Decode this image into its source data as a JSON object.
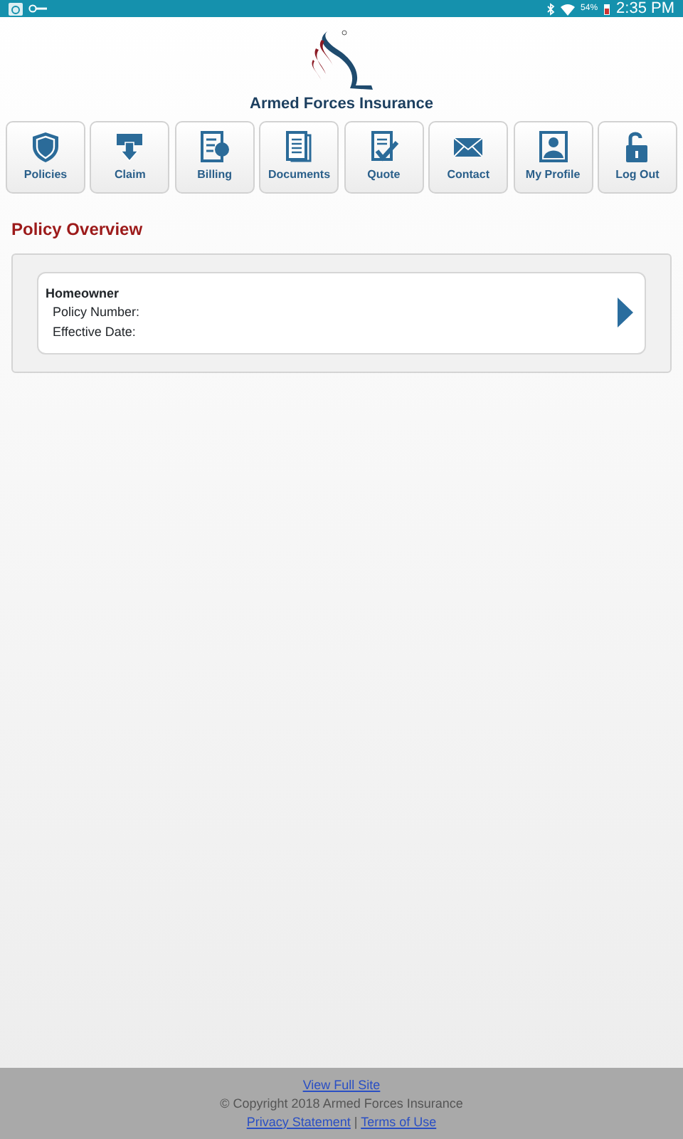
{
  "status_bar": {
    "battery": "54%",
    "time": "2:35 PM"
  },
  "logo": {
    "name": "Armed Forces Insurance"
  },
  "nav": [
    {
      "label": "Policies"
    },
    {
      "label": "Claim"
    },
    {
      "label": "Billing"
    },
    {
      "label": "Documents"
    },
    {
      "label": "Quote"
    },
    {
      "label": "Contact"
    },
    {
      "label": "My Profile"
    },
    {
      "label": "Log Out"
    }
  ],
  "section_title": "Policy Overview",
  "policies": [
    {
      "type": "Homeowner",
      "fields": [
        "Policy Number:",
        "Effective Date:"
      ]
    }
  ],
  "footer": {
    "full_site_link": "View Full Site",
    "copyright": "© Copyright 2018 Armed Forces Insurance",
    "links": [
      "Privacy Statement",
      "Terms of Use"
    ],
    "separator": "|"
  }
}
